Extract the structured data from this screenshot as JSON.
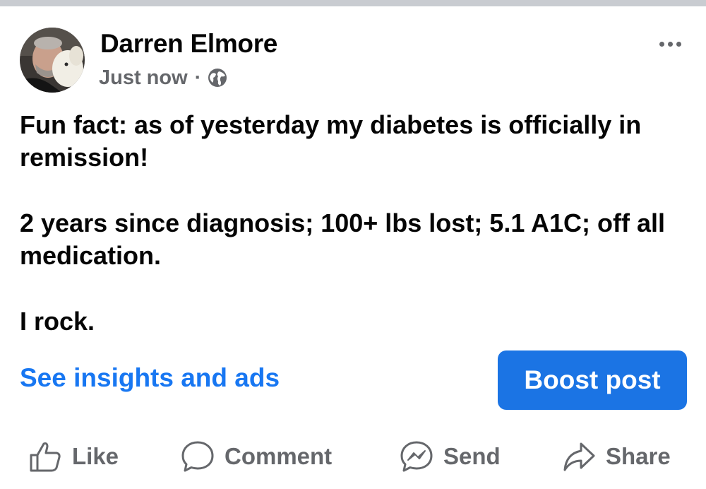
{
  "post": {
    "author": "Darren Elmore",
    "timestamp": "Just now",
    "separator": "·",
    "audience_icon": "globe-icon",
    "body": [
      "Fun fact:  as of yesterday my diabetes is officially in remission!",
      "2 years since diagnosis; 100+ lbs lost; 5.1 A1C; off all medication.",
      "I rock."
    ]
  },
  "insights_link": "See insights and ads",
  "boost_button": "Boost post",
  "actions": [
    {
      "label": "Like",
      "icon": "like-icon"
    },
    {
      "label": "Comment",
      "icon": "comment-icon"
    },
    {
      "label": "Send",
      "icon": "messenger-icon"
    },
    {
      "label": "Share",
      "icon": "share-icon"
    }
  ],
  "colors": {
    "text": "#050505",
    "secondary_text": "#65676b",
    "link": "#1877f2",
    "boost_button_bg": "#1b74e4",
    "top_strip": "#c9ccd1"
  }
}
